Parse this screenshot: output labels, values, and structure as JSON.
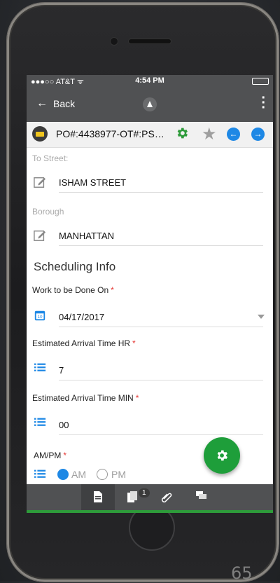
{
  "status_bar": {
    "carrier": "●●●○○ AT&T ᯤ",
    "time": "4:54 PM"
  },
  "nav": {
    "back_label": "Back",
    "back_icon": "arrow-left-icon",
    "menu_icon": "kebab-icon"
  },
  "record": {
    "title": "PO#:4438977-OT#:PS…",
    "icons": [
      "truck-icon",
      "gear-icon",
      "star-icon",
      "chevron-left-icon",
      "chevron-right-icon"
    ],
    "prev_glyph": "←",
    "next_glyph": "→"
  },
  "form": {
    "to_street": {
      "label": "To Street:",
      "value": "ISHAM STREET"
    },
    "borough": {
      "label": "Borough",
      "value": "MANHATTAN"
    },
    "section_title": "Scheduling Info",
    "work_date": {
      "label": "Work to be Done On",
      "value": "04/17/2017",
      "required": "*"
    },
    "arrival_hr": {
      "label": "Estimated Arrival Time HR",
      "value": "7",
      "required": "*"
    },
    "arrival_min": {
      "label": "Estimated Arrival Time MIN",
      "value": "00",
      "required": "*"
    },
    "ampm": {
      "label": "AM/PM",
      "required": "*",
      "options": [
        "AM",
        "PM"
      ],
      "selected": "AM"
    }
  },
  "bottom_bar": {
    "badge_count": "1"
  },
  "colors": {
    "accent": "#1e88e5",
    "fab": "#1e9e3a",
    "bar": "#505153",
    "required": "#e53935"
  },
  "page_number": "65"
}
